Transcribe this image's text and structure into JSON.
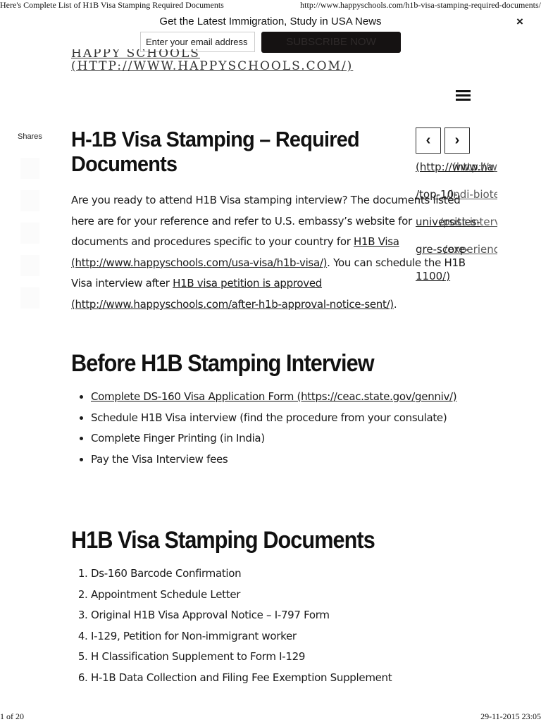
{
  "print_header": {
    "page_title": "Here's Complete List of H1B Visa Stamping Required Documents",
    "url": "http://www.happyschools.com/h1b-visa-stamping-required-documents/"
  },
  "newsletter": {
    "text": "Get the Latest Immigration, Study in USA News",
    "email_placeholder": "Enter your email address",
    "subscribe_label": "SUBSCRIBE NOW",
    "close_icon": "×"
  },
  "site": {
    "logo_line1": "HAPPY SCHOOLS",
    "logo_line2": "(HTTP://WWW.HAPPYSCHOOLS.COM/)"
  },
  "shares": {
    "label": "Shares",
    "buttons": [
      "share-1",
      "share-2",
      "share-3",
      "share-4",
      "share-5"
    ]
  },
  "nav": {
    "prev_icon": "‹",
    "next_icon": "›",
    "overlap_lines": [
      {
        "a": "(http://www.ha",
        "b": "(http://www.ha"
      },
      {
        "a": "/top-10-",
        "b": "/indi-biote"
      },
      {
        "a": "universities-",
        "b": "/post-interv"
      },
      {
        "a": "gre-score-",
        "b": "/experienc"
      },
      {
        "a": "1100/)",
        "b": ""
      }
    ]
  },
  "article": {
    "title": "H-1B Visa Stamping – Required Documents",
    "intro_part1": "Are you ready to attend H1B Visa stamping interview? The documents listed here are for your reference and refer to U.S. embassy’s website for documents and procedures specific to your country for ",
    "intro_link1": "H1B Visa (http://www.happyschools.com/usa-visa/h1b-visa/)",
    "intro_part2": ".  You can schedule the H1B Visa interview after ",
    "intro_link2": "H1B visa petition is approved (http://www.happyschools.com/after-h1b-approval-notice-sent/)",
    "intro_part3": ".",
    "section1_heading": "Before H1B Stamping Interview",
    "section1_items": [
      {
        "text": "Complete DS-160 Visa Application Form (https://ceac.state.gov/genniv/)",
        "link": true
      },
      {
        "text": "Schedule H1B Visa interview (find the procedure from your consulate)",
        "link": false
      },
      {
        "text": "Complete Finger Printing (in India)",
        "link": false
      },
      {
        "text": "Pay the Visa Interview fees",
        "link": false
      }
    ],
    "section2_heading": "H1B Visa Stamping Documents",
    "section2_items": [
      "Ds-160 Barcode Confirmation",
      "Appointment Schedule Letter",
      "Original H1B Visa Approval Notice – I-797 Form",
      "I-129, Petition for Non-immigrant worker",
      "H Classification Supplement to Form I-129",
      "H-1B Data Collection and Filing Fee Exemption Supplement"
    ]
  },
  "print_footer": {
    "page": "1 of 20",
    "datetime": "29-11-2015 23:05"
  }
}
